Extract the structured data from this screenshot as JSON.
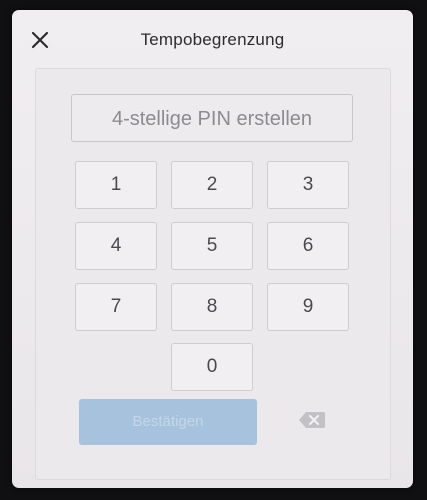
{
  "dialog": {
    "title": "Tempobegrenzung",
    "close_icon": "close-icon"
  },
  "pin": {
    "placeholder": "4-stellige PIN erstellen",
    "value": ""
  },
  "keypad": {
    "keys": [
      "1",
      "2",
      "3",
      "4",
      "5",
      "6",
      "7",
      "8",
      "9",
      "0"
    ]
  },
  "actions": {
    "confirm_label": "Bestätigen",
    "confirm_enabled": false,
    "backspace_icon": "backspace-icon"
  },
  "colors": {
    "background": "#101012",
    "dialog": "#efecf0",
    "confirm_disabled": "#a7c2dd",
    "backspace": "#c3c0c6"
  }
}
